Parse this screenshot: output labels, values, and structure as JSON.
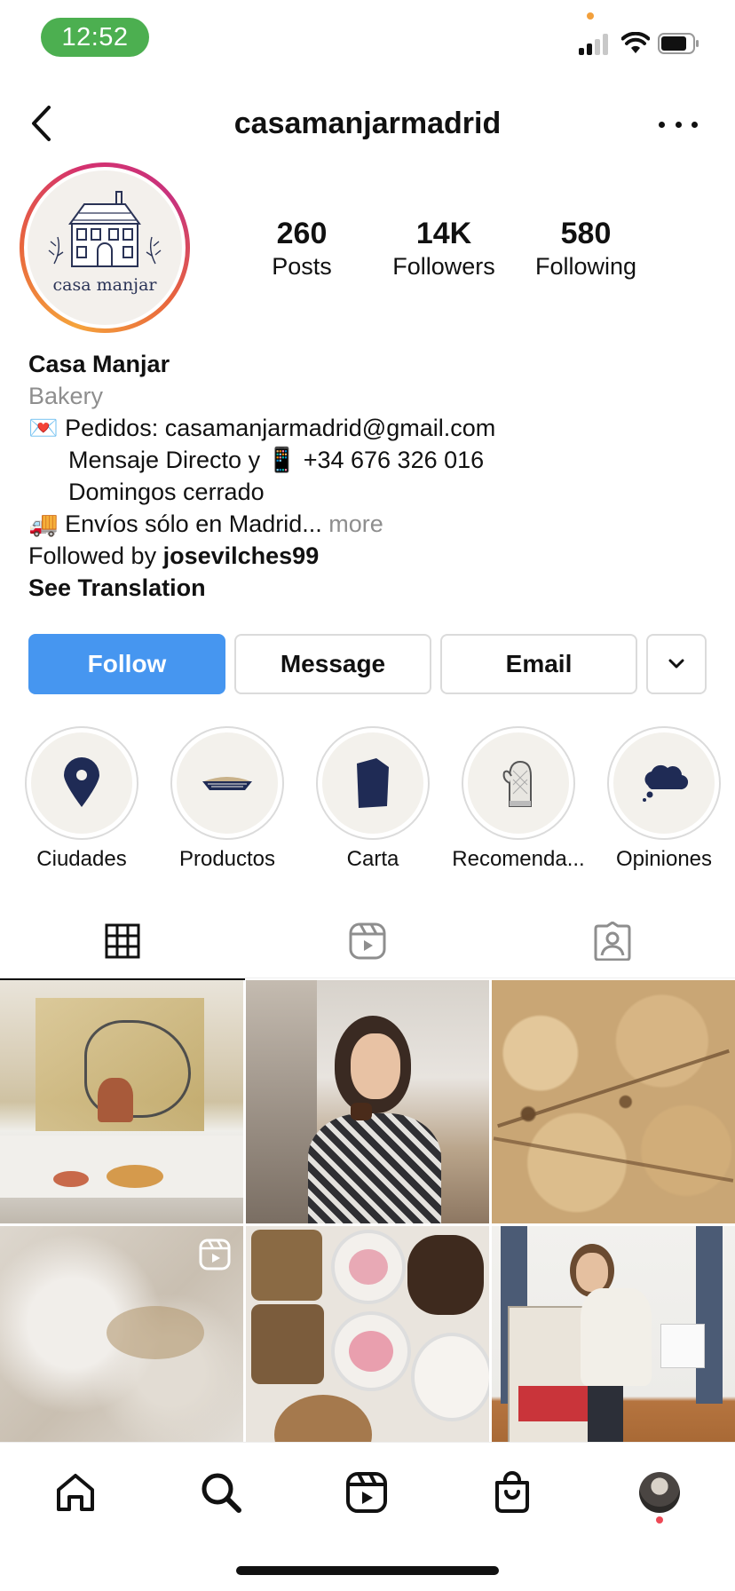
{
  "status_bar": {
    "time": "12:52",
    "colors": {
      "time_pill": "#4caf50",
      "privacy_dot": "#f2a03c"
    }
  },
  "header": {
    "username": "casamanjarmadrid"
  },
  "profile": {
    "logo_text": "casa manjar",
    "stats": [
      {
        "value": "260",
        "label": "Posts"
      },
      {
        "value": "14K",
        "label": "Followers"
      },
      {
        "value": "580",
        "label": "Following"
      }
    ],
    "name": "Casa Manjar",
    "category": "Bakery",
    "bio_lines": [
      "💌 Pedidos: casamanjarmadrid@gmail.com",
      "Mensaje Directo y 📱 +34 676 326 016",
      "Domingos cerrado",
      "🚚 Envíos sólo en Madrid..."
    ],
    "more_label": "more",
    "followed_by_prefix": "Followed by",
    "followed_by_user": "josevilches99",
    "see_translation": "See Translation"
  },
  "actions": {
    "follow": "Follow",
    "message": "Message",
    "email": "Email",
    "follow_color": "#4696f0"
  },
  "highlights": [
    {
      "label": "Ciudades",
      "icon": "map-pin-icon"
    },
    {
      "label": "Productos",
      "icon": "pie-icon"
    },
    {
      "label": "Carta",
      "icon": "menu-card-icon"
    },
    {
      "label": "Recomenda...",
      "icon": "oven-mitt-icon"
    },
    {
      "label": "Opiniones",
      "icon": "thought-cloud-icon"
    }
  ],
  "tabs": [
    {
      "name": "posts-grid",
      "icon": "grid-icon",
      "active": true
    },
    {
      "name": "reels",
      "icon": "reels-icon",
      "active": false
    },
    {
      "name": "tagged",
      "icon": "tagged-person-icon",
      "active": false
    }
  ],
  "posts": [
    {
      "description": "table-with-candles-and-food",
      "is_reel": false
    },
    {
      "description": "woman-eating-pastry",
      "is_reel": false
    },
    {
      "description": "brownie-close-up",
      "is_reel": false
    },
    {
      "description": "flour-texture",
      "is_reel": true
    },
    {
      "description": "assorted-cakes-and-cupcakes",
      "is_reel": false
    },
    {
      "description": "woman-with-delivery-box",
      "is_reel": false
    }
  ],
  "bottom_nav": [
    {
      "name": "home",
      "icon": "home-icon"
    },
    {
      "name": "search",
      "icon": "search-icon"
    },
    {
      "name": "reels",
      "icon": "reels-icon"
    },
    {
      "name": "shop",
      "icon": "shopping-bag-icon"
    },
    {
      "name": "profile",
      "icon": "profile-avatar-icon"
    }
  ]
}
